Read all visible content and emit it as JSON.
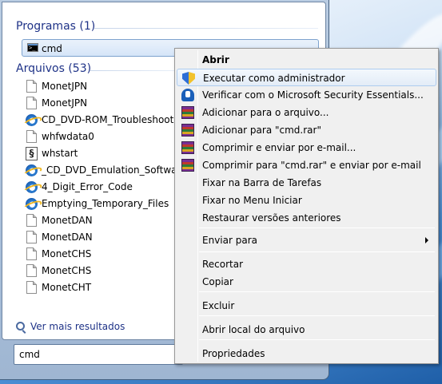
{
  "start_menu": {
    "programs_header": "Programas (1)",
    "program": {
      "label": "cmd",
      "icon": "command-prompt-icon"
    },
    "files_header": "Arquivos (53)",
    "files": [
      {
        "label": "MonetJPN",
        "icon": "document-icon"
      },
      {
        "label": "MonetJPN",
        "icon": "document-icon"
      },
      {
        "label": "CD_DVD-ROM_Troubleshooting",
        "icon": "ie-icon"
      },
      {
        "label": "whfwdata0",
        "icon": "document-icon"
      },
      {
        "label": "whstart",
        "icon": "script-icon"
      },
      {
        "label": "_CD_DVD_Emulation_Software_D",
        "icon": "ie-icon"
      },
      {
        "label": "4_Digit_Error_Code",
        "icon": "ie-icon"
      },
      {
        "label": "Emptying_Temporary_Files",
        "icon": "ie-icon"
      },
      {
        "label": "MonetDAN",
        "icon": "document-icon"
      },
      {
        "label": "MonetDAN",
        "icon": "document-icon"
      },
      {
        "label": "MonetCHS",
        "icon": "document-icon"
      },
      {
        "label": "MonetCHS",
        "icon": "document-icon"
      },
      {
        "label": "MonetCHT",
        "icon": "document-icon"
      }
    ],
    "see_more": "Ver mais resultados",
    "search_value": "cmd"
  },
  "context_menu": {
    "items": [
      {
        "label": "Abrir",
        "bold": true
      },
      {
        "label": "Executar como administrador",
        "icon": "uac-shield-icon",
        "hover": true
      },
      {
        "label": "Verificar com o Microsoft Security Essentials...",
        "icon": "security-essentials-icon"
      },
      {
        "label": "Adicionar para o arquivo...",
        "icon": "winrar-icon"
      },
      {
        "label": "Adicionar para \"cmd.rar\"",
        "icon": "winrar-icon"
      },
      {
        "label": "Comprimir e enviar por e-mail...",
        "icon": "winrar-icon"
      },
      {
        "label": "Comprimir para \"cmd.rar\" e enviar por e-mail",
        "icon": "winrar-icon"
      },
      {
        "label": "Fixar na Barra de Tarefas"
      },
      {
        "label": "Fixar no Menu Iniciar"
      },
      {
        "label": "Restaurar versões anteriores"
      },
      {
        "label": "Enviar para",
        "submenu": true
      },
      {
        "label": "Recortar"
      },
      {
        "label": "Copiar"
      },
      {
        "label": "Excluir"
      },
      {
        "label": "Abrir local do arquivo"
      },
      {
        "label": "Propriedades"
      }
    ]
  }
}
